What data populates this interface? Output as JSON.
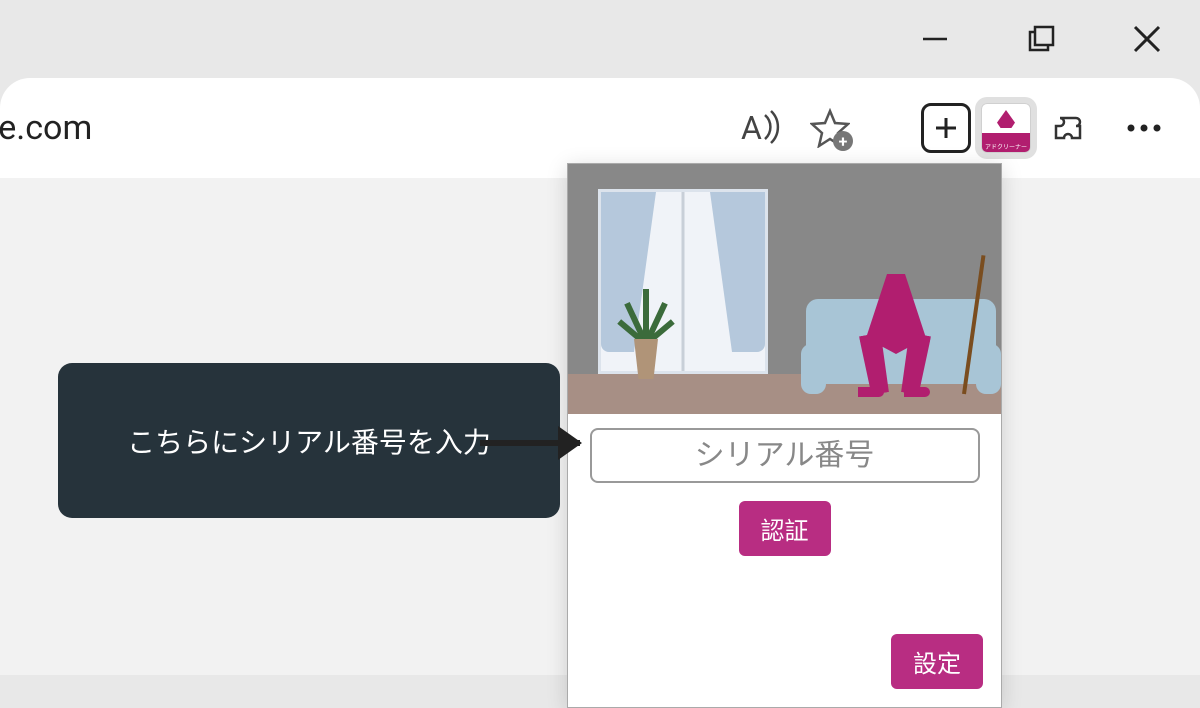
{
  "window": {
    "minimize": "—",
    "maximize": "❐",
    "close": "✕"
  },
  "toolbar": {
    "url_fragment": "le.com",
    "read_aloud": "A",
    "favorites": "★",
    "new_tab_plus": "+",
    "extensions": "⋮"
  },
  "popup": {
    "serial_placeholder": "シリアル番号",
    "auth_button": "認証",
    "settings_button": "設定"
  },
  "tooltip": {
    "text": "こちらにシリアル番号を入力"
  },
  "colors": {
    "accent": "#b82d82",
    "tooltip_bg": "#26333b"
  }
}
